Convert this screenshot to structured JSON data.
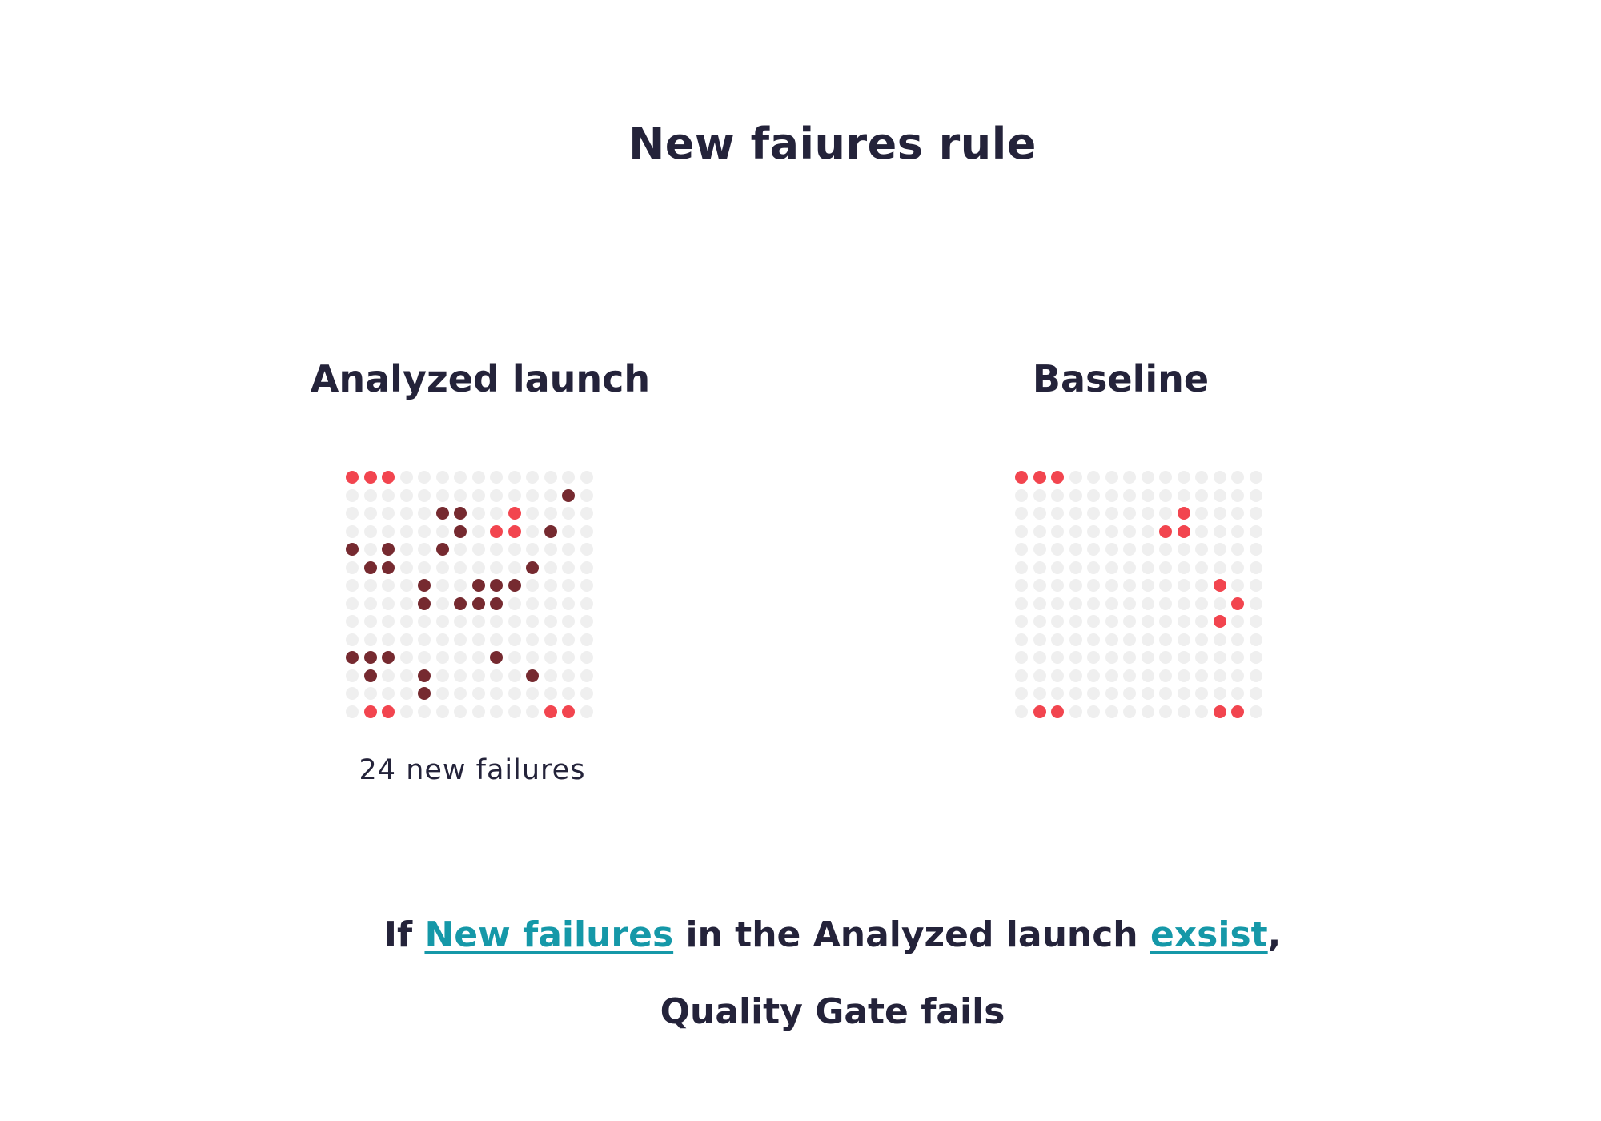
{
  "title": "New faiures rule",
  "panels": {
    "analyzed": {
      "title": "Analyzed launch",
      "caption": "24 new failures"
    },
    "baseline": {
      "title": "Baseline"
    }
  },
  "rule": {
    "part1": "If ",
    "term1": "New failures",
    "part2": " in the Analyzed launch ",
    "term2": "exsist",
    "part3": ",",
    "line2": "Quality Gate fails"
  },
  "colors": {
    "text": "#24233a",
    "link": "#1598a8",
    "empty_dot": "#efefef",
    "existing_failure": "#f2454f",
    "new_failure": "#762a30"
  },
  "grids": {
    "rows": 14,
    "cols": 14,
    "analyzed": {
      "existing_failures": [
        [
          0,
          0
        ],
        [
          0,
          1
        ],
        [
          0,
          2
        ],
        [
          2,
          9
        ],
        [
          3,
          8
        ],
        [
          3,
          9
        ],
        [
          13,
          1
        ],
        [
          13,
          2
        ],
        [
          13,
          11
        ],
        [
          13,
          12
        ]
      ],
      "new_failures": [
        [
          1,
          12
        ],
        [
          2,
          5
        ],
        [
          2,
          6
        ],
        [
          3,
          6
        ],
        [
          3,
          11
        ],
        [
          4,
          0
        ],
        [
          4,
          2
        ],
        [
          4,
          5
        ],
        [
          5,
          1
        ],
        [
          5,
          2
        ],
        [
          5,
          10
        ],
        [
          6,
          4
        ],
        [
          6,
          7
        ],
        [
          6,
          8
        ],
        [
          6,
          9
        ],
        [
          7,
          4
        ],
        [
          7,
          6
        ],
        [
          7,
          7
        ],
        [
          7,
          8
        ],
        [
          10,
          0
        ],
        [
          10,
          1
        ],
        [
          10,
          2
        ],
        [
          10,
          8
        ],
        [
          11,
          1
        ],
        [
          11,
          4
        ],
        [
          11,
          10
        ],
        [
          12,
          4
        ]
      ]
    },
    "baseline": {
      "existing_failures": [
        [
          0,
          0
        ],
        [
          0,
          1
        ],
        [
          0,
          2
        ],
        [
          2,
          9
        ],
        [
          3,
          8
        ],
        [
          3,
          9
        ],
        [
          6,
          11
        ],
        [
          7,
          12
        ],
        [
          8,
          11
        ],
        [
          13,
          1
        ],
        [
          13,
          2
        ],
        [
          13,
          11
        ],
        [
          13,
          12
        ]
      ],
      "new_failures": []
    }
  }
}
